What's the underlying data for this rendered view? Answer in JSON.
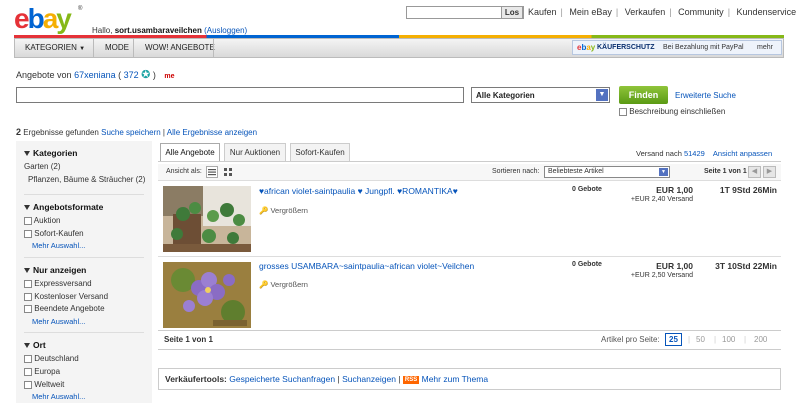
{
  "header": {
    "logo_text": "ebay",
    "logo_tm": "®",
    "greeting_prefix": "Hallo, ",
    "greeting_user": "sort.usambaraveilchen",
    "logout": "(Ausloggen)",
    "search_button": "Los",
    "nav": [
      "Kaufen",
      "Mein eBay",
      "Verkaufen",
      "Community",
      "Kundenservice"
    ]
  },
  "navbar": {
    "items": [
      "KATEGORIEN",
      "MODE",
      "WOW! ANGEBOTE"
    ],
    "kaeuferschutz_brand": "ebay",
    "kaeuferschutz_label": "KÄUFERSCHUTZ",
    "kaeuferschutz_text": "Bei Bezahlung mit PayPal",
    "kaeuferschutz_more": "mehr"
  },
  "seller": {
    "prefix": "Angebote von",
    "name": "67xeniana",
    "score": "372",
    "me": "me"
  },
  "search": {
    "category_value": "Alle Kategorien",
    "button": "Finden",
    "advanced": "Erweiterte Suche",
    "desc_checkbox": "Beschreibung einschließen"
  },
  "results": {
    "count": "2",
    "text": "Ergebnisse gefunden",
    "save": "Suche speichern",
    "all": "Alle Ergebnisse anzeigen"
  },
  "sidebar": {
    "kategorien": {
      "title": "Kategorien",
      "items": [
        {
          "label": "Garten",
          "count": "(2)"
        },
        {
          "label": "Pflanzen, Bäume & Sträucher",
          "count": "(2)"
        }
      ]
    },
    "formate": {
      "title": "Angebotsformate",
      "items": [
        "Auktion",
        "Sofort-Kaufen"
      ],
      "more": "Mehr Auswahl..."
    },
    "anzeigen": {
      "title": "Nur anzeigen",
      "items": [
        "Expressversand",
        "Kostenloser Versand",
        "Beendete Angebote"
      ],
      "more": "Mehr Auswahl..."
    },
    "ort": {
      "title": "Ort",
      "items": [
        "Deutschland",
        "Europa",
        "Weltweit"
      ],
      "more": "Mehr Auswahl..."
    }
  },
  "tabs": [
    "Alle Angebote",
    "Nur Auktionen",
    "Sofort-Kaufen"
  ],
  "location": {
    "prefix": "Versand nach",
    "zip": "51429",
    "adjust": "Ansicht anpassen"
  },
  "toolbar": {
    "view_label": "Ansicht als:",
    "sort_label": "Sortieren nach:",
    "sort_value": "Beliebteste Artikel",
    "page_label": "Seite 1 von 1"
  },
  "items": [
    {
      "title": "♥african violet-saintpaulia ♥ Jungpfl. ♥ROMANTIKA♥",
      "zoom": "Vergrößern",
      "bids": "0 Gebote",
      "price": "EUR 1,00",
      "shipping": "+EUR 2,40 Versand",
      "time": "1T 9Std 26Min"
    },
    {
      "title": "grosses USAMBARA~saintpaulia~african violet~Veilchen",
      "zoom": "Vergrößern",
      "bids": "0 Gebote",
      "price": "EUR 1,00",
      "shipping": "+EUR 2,50 Versand",
      "time": "3T 10Std 22Min"
    }
  ],
  "pager": {
    "page_prefix": "Seite ",
    "page_current": "1",
    "page_mid": " von ",
    "page_total": "1",
    "per_page_label": "Artikel pro Seite:",
    "options": [
      "25",
      "50",
      "100",
      "200"
    ]
  },
  "tools": {
    "label": "Verkäufertools:",
    "links": [
      "Gespeicherte Suchanfragen",
      "Suchanzeigen"
    ],
    "rss": "RSS",
    "more": "Mehr zum Thema"
  },
  "colors": {
    "link": "#0654ba",
    "finden": "#6aaa1e",
    "ebay_red": "#e53238",
    "ebay_blue": "#0064d2",
    "ebay_yellow": "#f5af02",
    "ebay_green": "#86b817"
  }
}
